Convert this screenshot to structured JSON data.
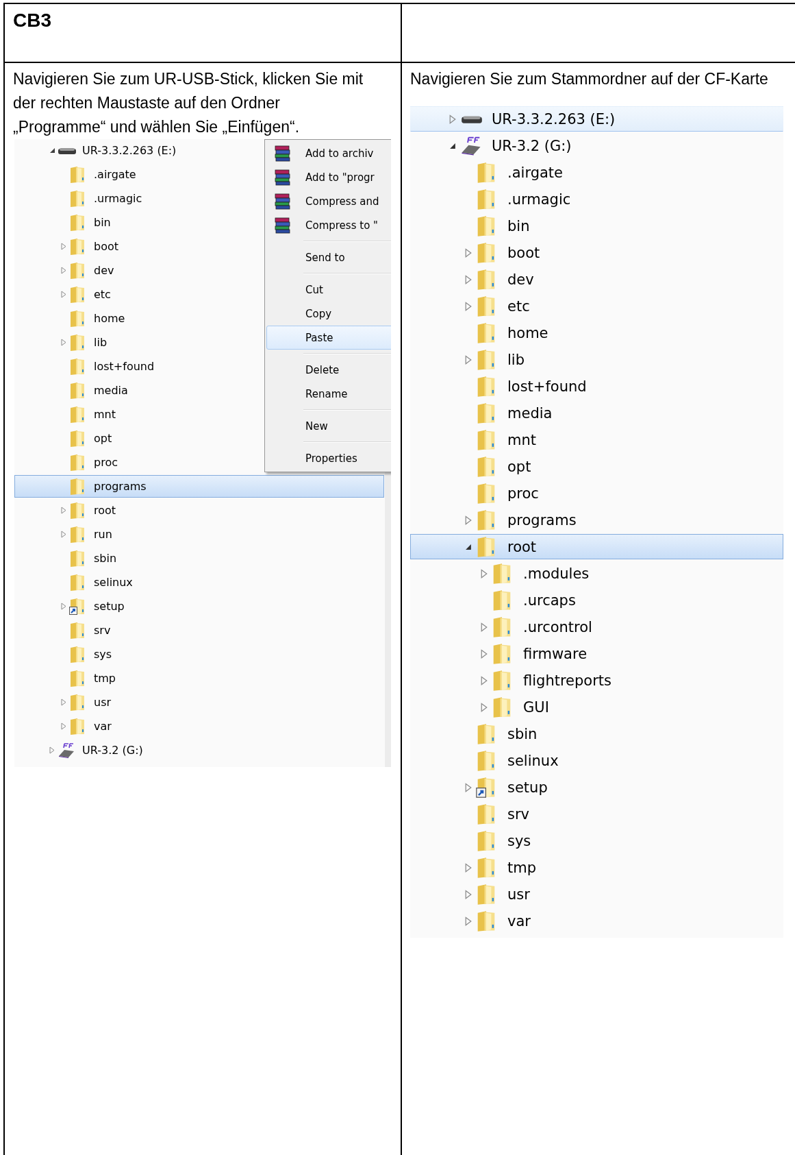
{
  "header": {
    "title": "CB3"
  },
  "left": {
    "instruction": "Navigieren Sie zum UR-USB-Stick, klicken Sie mit der rechten Maustaste auf den Ordner „Programme“ und wählen Sie „Einfügen“.",
    "explorer": {
      "tree": [
        {
          "label": "UR-3.3.2.263 (E:)",
          "kind": "drive",
          "expanded": true,
          "selected": false,
          "children": [
            {
              "label": ".airgate",
              "kind": "folder",
              "selected": false
            },
            {
              "label": ".urmagic",
              "kind": "folder",
              "selected": false
            },
            {
              "label": "bin",
              "kind": "folder",
              "selected": false
            },
            {
              "label": "boot",
              "kind": "folder",
              "expanded": false,
              "selected": false
            },
            {
              "label": "dev",
              "kind": "folder",
              "expanded": false,
              "selected": false
            },
            {
              "label": "etc",
              "kind": "folder",
              "expanded": false,
              "selected": false
            },
            {
              "label": "home",
              "kind": "folder",
              "selected": false
            },
            {
              "label": "lib",
              "kind": "folder",
              "expanded": false,
              "selected": false
            },
            {
              "label": "lost+found",
              "kind": "folder",
              "selected": false
            },
            {
              "label": "media",
              "kind": "folder",
              "selected": false
            },
            {
              "label": "mnt",
              "kind": "folder",
              "selected": false
            },
            {
              "label": "opt",
              "kind": "folder",
              "selected": false
            },
            {
              "label": "proc",
              "kind": "folder",
              "selected": false
            },
            {
              "label": "programs",
              "kind": "folder",
              "selected": true
            },
            {
              "label": "root",
              "kind": "folder",
              "expanded": false,
              "selected": false
            },
            {
              "label": "run",
              "kind": "folder",
              "expanded": false,
              "selected": false
            },
            {
              "label": "sbin",
              "kind": "folder",
              "selected": false
            },
            {
              "label": "selinux",
              "kind": "folder",
              "selected": false
            },
            {
              "label": "setup",
              "kind": "shortcut-folder",
              "expanded": false,
              "selected": false
            },
            {
              "label": "srv",
              "kind": "folder",
              "selected": false
            },
            {
              "label": "sys",
              "kind": "folder",
              "selected": false
            },
            {
              "label": "tmp",
              "kind": "folder",
              "selected": false
            },
            {
              "label": "usr",
              "kind": "folder",
              "expanded": false,
              "selected": false
            },
            {
              "label": "var",
              "kind": "folder",
              "expanded": false,
              "selected": false
            }
          ]
        },
        {
          "label": "UR-3.2 (G:)",
          "kind": "cf-drive",
          "expanded": false,
          "selected": false
        }
      ],
      "context_menu": {
        "groups": [
          [
            {
              "label": "Add to archiv",
              "kind": "archiver",
              "selected": false
            },
            {
              "label": "Add to \"progr",
              "kind": "archiver",
              "selected": false
            },
            {
              "label": "Compress and",
              "kind": "archiver",
              "selected": false
            },
            {
              "label": "Compress to \"",
              "kind": "archiver",
              "selected": false
            }
          ],
          [
            {
              "label": "Send to",
              "kind": "plain",
              "selected": false
            }
          ],
          [
            {
              "label": "Cut",
              "kind": "plain",
              "selected": false
            },
            {
              "label": "Copy",
              "kind": "plain",
              "selected": false
            },
            {
              "label": "Paste",
              "kind": "plain",
              "selected": true
            }
          ],
          [
            {
              "label": "Delete",
              "kind": "plain",
              "selected": false
            },
            {
              "label": "Rename",
              "kind": "plain",
              "selected": false
            }
          ],
          [
            {
              "label": "New",
              "kind": "plain",
              "selected": false
            }
          ],
          [
            {
              "label": "Properties",
              "kind": "plain",
              "selected": false
            }
          ]
        ]
      }
    }
  },
  "right": {
    "instruction": "Navigieren Sie zum Stammordner auf der CF-Karte",
    "explorer": {
      "tree": [
        {
          "label": "UR-3.3.2.263 (E:)",
          "kind": "drive",
          "expanded": false,
          "selected": false,
          "hovered": true
        },
        {
          "label": "UR-3.2 (G:)",
          "kind": "cf-drive",
          "expanded": true,
          "selected": false,
          "children": [
            {
              "label": ".airgate",
              "kind": "folder",
              "selected": false
            },
            {
              "label": ".urmagic",
              "kind": "folder",
              "selected": false
            },
            {
              "label": "bin",
              "kind": "folder",
              "selected": false
            },
            {
              "label": "boot",
              "kind": "folder",
              "expanded": false,
              "selected": false
            },
            {
              "label": "dev",
              "kind": "folder",
              "expanded": false,
              "selected": false
            },
            {
              "label": "etc",
              "kind": "folder",
              "expanded": false,
              "selected": false
            },
            {
              "label": "home",
              "kind": "folder",
              "selected": false
            },
            {
              "label": "lib",
              "kind": "folder",
              "expanded": false,
              "selected": false
            },
            {
              "label": "lost+found",
              "kind": "folder",
              "selected": false
            },
            {
              "label": "media",
              "kind": "folder",
              "selected": false
            },
            {
              "label": "mnt",
              "kind": "folder",
              "selected": false
            },
            {
              "label": "opt",
              "kind": "folder",
              "selected": false
            },
            {
              "label": "proc",
              "kind": "folder",
              "selected": false
            },
            {
              "label": "programs",
              "kind": "folder",
              "expanded": false,
              "selected": false
            },
            {
              "label": "root",
              "kind": "folder",
              "expanded": true,
              "selected": true,
              "children": [
                {
                  "label": ".modules",
                  "kind": "folder",
                  "expanded": false,
                  "selected": false
                },
                {
                  "label": ".urcaps",
                  "kind": "folder",
                  "selected": false
                },
                {
                  "label": ".urcontrol",
                  "kind": "folder",
                  "expanded": false,
                  "selected": false
                },
                {
                  "label": "firmware",
                  "kind": "folder",
                  "expanded": false,
                  "selected": false
                },
                {
                  "label": "flightreports",
                  "kind": "folder",
                  "expanded": false,
                  "selected": false
                },
                {
                  "label": "GUI",
                  "kind": "folder",
                  "expanded": false,
                  "selected": false
                }
              ]
            },
            {
              "label": "sbin",
              "kind": "folder",
              "selected": false
            },
            {
              "label": "selinux",
              "kind": "folder",
              "selected": false
            },
            {
              "label": "setup",
              "kind": "shortcut-folder",
              "expanded": false,
              "selected": false
            },
            {
              "label": "srv",
              "kind": "folder",
              "selected": false
            },
            {
              "label": "sys",
              "kind": "folder",
              "selected": false
            },
            {
              "label": "tmp",
              "kind": "folder",
              "expanded": false,
              "selected": false
            },
            {
              "label": "usr",
              "kind": "folder",
              "expanded": false,
              "selected": false
            },
            {
              "label": "var",
              "kind": "folder",
              "expanded": false,
              "selected": false
            }
          ]
        }
      ]
    }
  }
}
